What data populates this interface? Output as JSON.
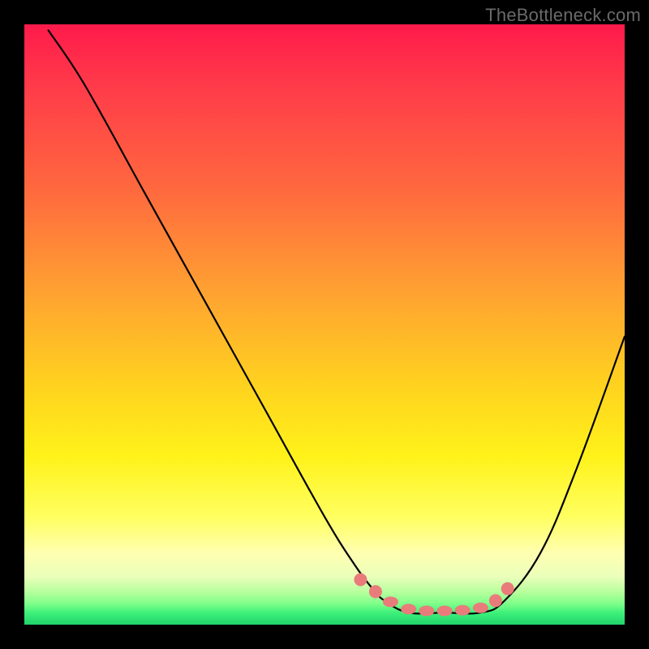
{
  "watermark": "TheBottleneck.com",
  "domain": "Chart",
  "colors": {
    "bead": "#e97b7b",
    "curve": "#000000",
    "frame": "#000000"
  },
  "chart_data": {
    "type": "line",
    "title": "",
    "xlabel": "",
    "ylabel": "",
    "xlim": [
      0,
      100
    ],
    "ylim": [
      0,
      100
    ],
    "grid": false,
    "legend": false,
    "note": "Unlabeled bottleneck-style V-curve over a vertical red→green gradient. x and y are approximate percentages of the plot area; y=0 is the bottom (green) edge. Values estimated from pixel positions.",
    "series": [
      {
        "name": "bottleneck-curve",
        "x": [
          4,
          10,
          20,
          30,
          40,
          50,
          55,
          58,
          60,
          64,
          70,
          76,
          80,
          86,
          92,
          100
        ],
        "y": [
          99,
          90,
          72,
          54,
          36,
          18,
          10,
          6,
          4,
          2,
          2,
          2,
          4,
          12,
          26,
          48
        ]
      }
    ],
    "markers": {
      "name": "highlight-beads",
      "note": "Salmon dots tracing the valley, slightly above the green band.",
      "x": [
        56,
        58.5,
        61,
        64,
        67,
        70,
        73,
        76,
        78.5,
        80.5
      ],
      "y": [
        7.5,
        5.5,
        3.8,
        2.6,
        2.3,
        2.3,
        2.4,
        2.8,
        4.0,
        6.0
      ]
    }
  }
}
